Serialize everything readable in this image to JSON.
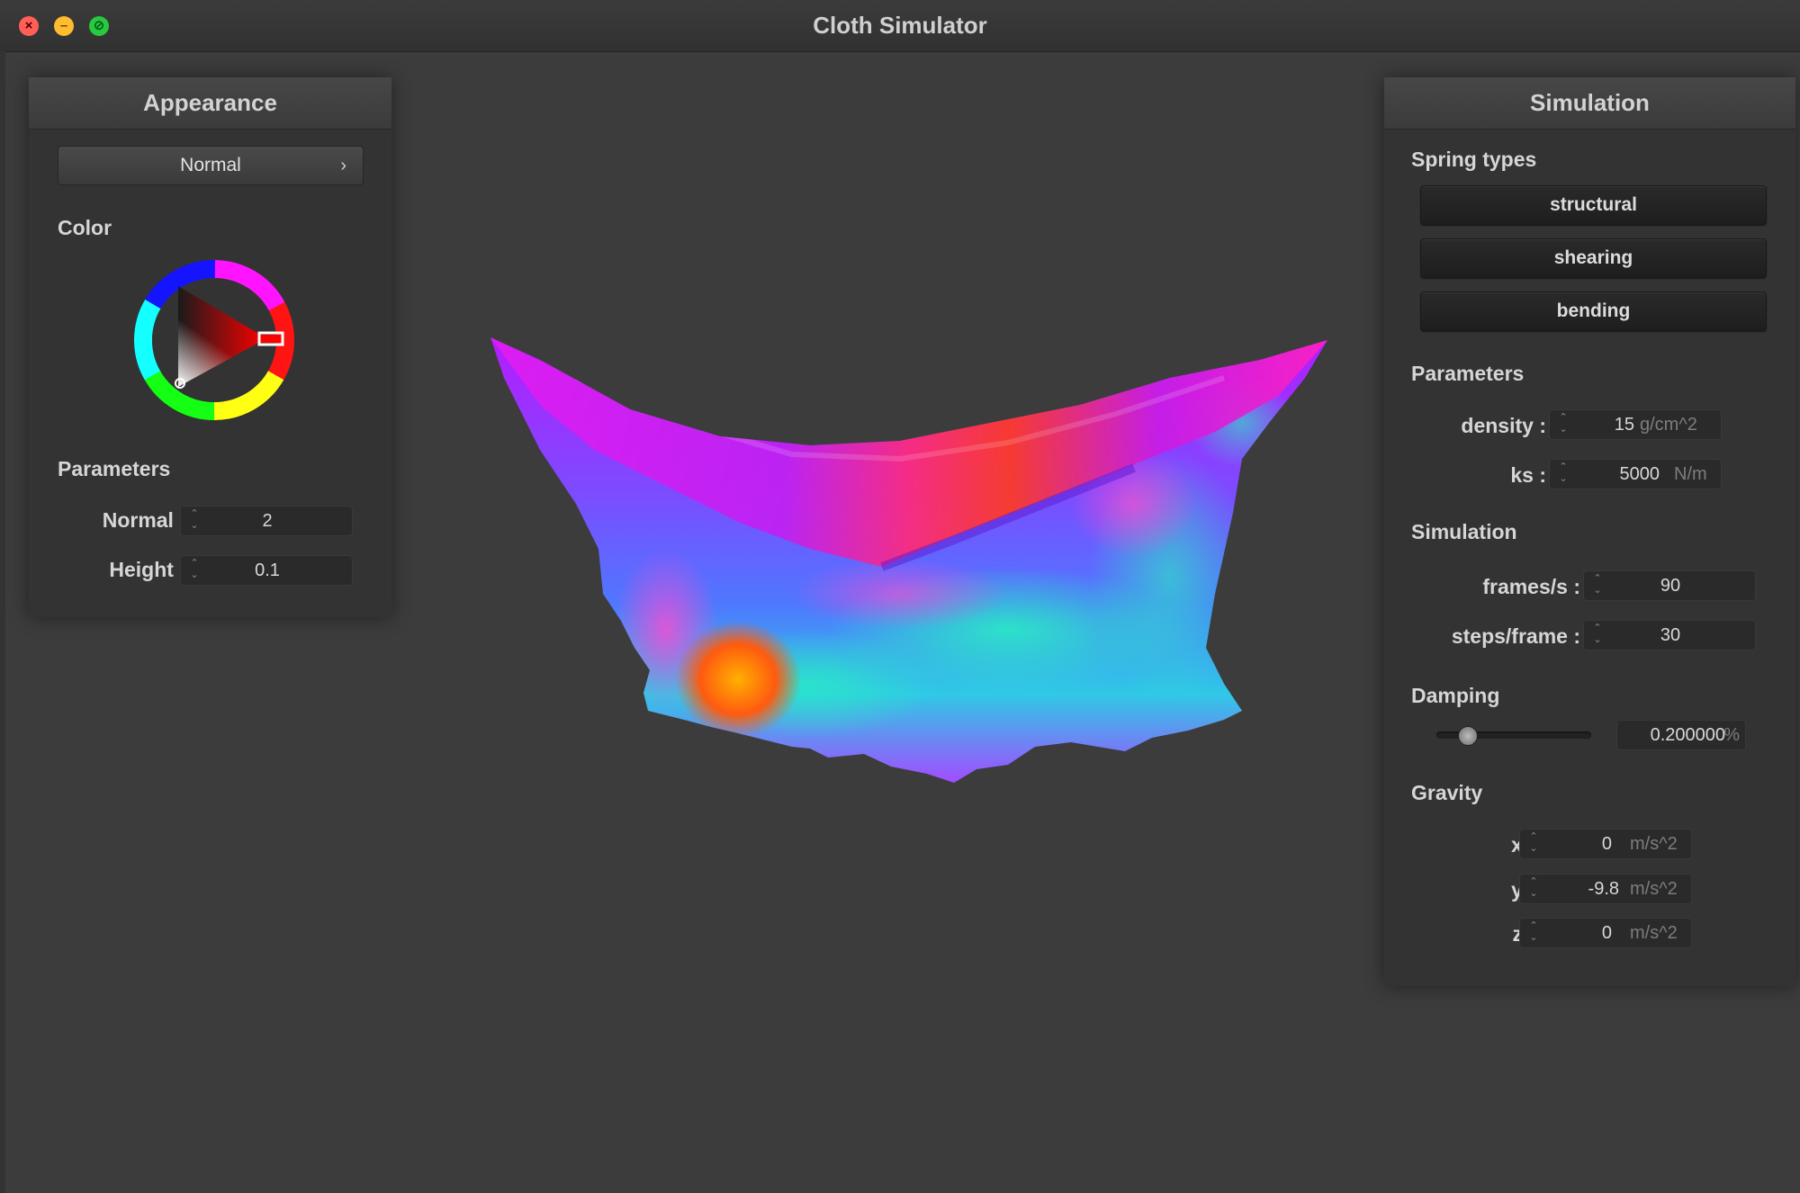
{
  "window": {
    "title": "Cloth Simulator"
  },
  "appearance": {
    "header": "Appearance",
    "shader_select": "Normal",
    "color_label": "Color",
    "params_label": "Parameters",
    "params": [
      {
        "label": "Normal :",
        "value": "2"
      },
      {
        "label": "Height :",
        "value": "0.1"
      }
    ]
  },
  "simulation": {
    "header": "Simulation",
    "spring_types_label": "Spring types",
    "spring_types": [
      "structural",
      "shearing",
      "bending"
    ],
    "parameters_label": "Parameters",
    "density": {
      "label": "density :",
      "value": "15",
      "unit": "g/cm^2"
    },
    "ks": {
      "label": "ks :",
      "value": "5000",
      "unit": "N/m"
    },
    "sim_label": "Simulation",
    "frames": {
      "label": "frames/s :",
      "value": "90"
    },
    "steps": {
      "label": "steps/frame :",
      "value": "30"
    },
    "damping_label": "Damping",
    "damping": {
      "value": "0.200000",
      "unit": "%",
      "slider_fraction": 0.2
    },
    "gravity_label": "Gravity",
    "gravity": [
      {
        "label": "x :",
        "value": "0",
        "unit": "m/s^2"
      },
      {
        "label": "y :",
        "value": "-9.8",
        "unit": "m/s^2"
      },
      {
        "label": "z :",
        "value": "0",
        "unit": "m/s^2"
      }
    ]
  },
  "colors": {
    "background": "#3c3c3c",
    "panel": "#333333",
    "selected_color": "#ff0000"
  },
  "icons": {
    "close": "close-icon",
    "minimize": "minimize-icon",
    "maximize": "maximize-icon",
    "combo": "chevron-right-icon",
    "spinner": "spinner-arrows-icon"
  }
}
